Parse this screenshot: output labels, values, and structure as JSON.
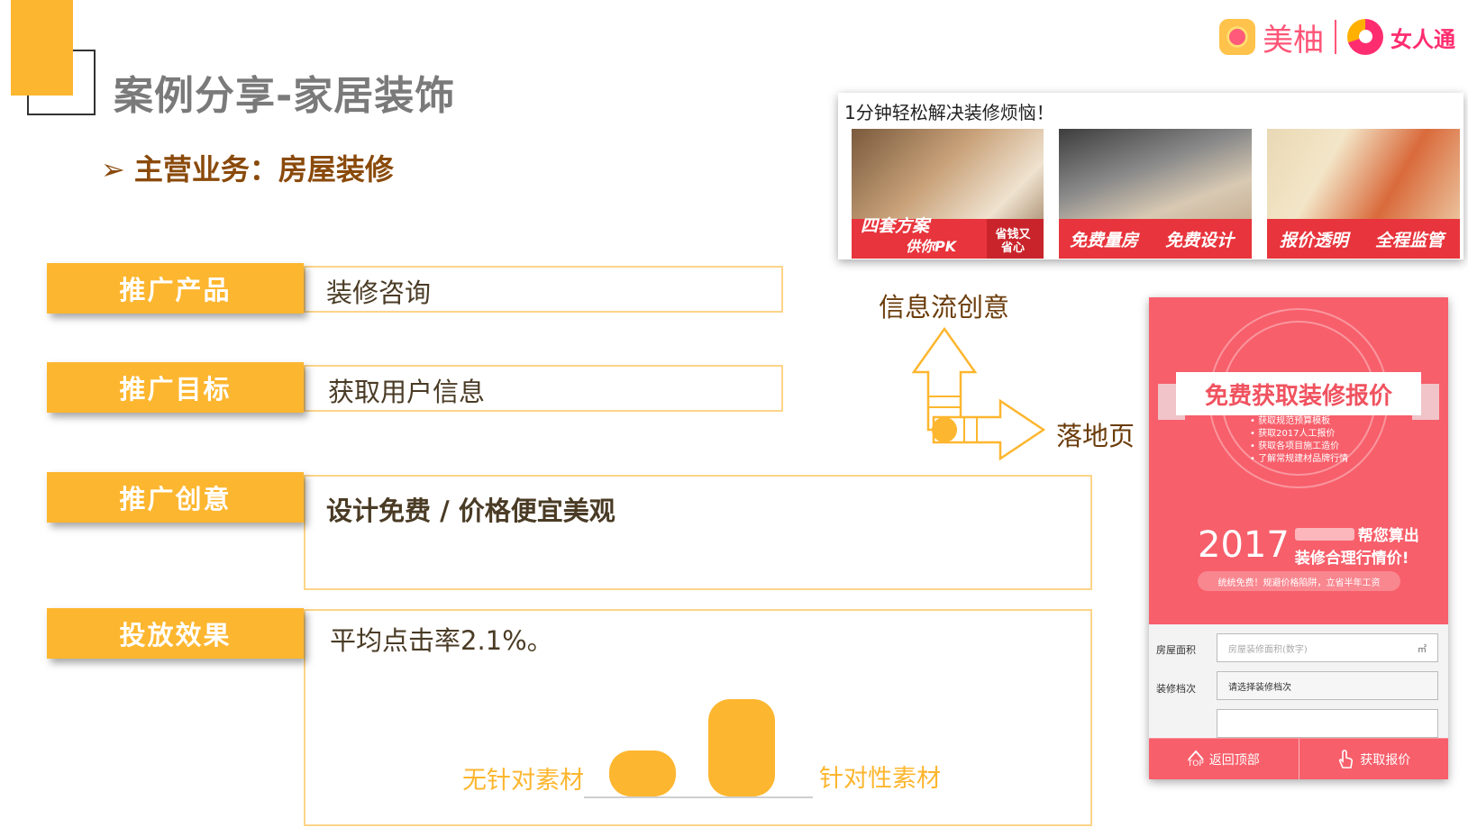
{
  "page": {
    "title": "案例分享-家居装饰",
    "subtitle_arrow": "➢",
    "subtitle": "主营业务：房屋装修"
  },
  "logos": {
    "meiyou": "美柚",
    "nvrentong": "女人通"
  },
  "rows": [
    {
      "label": "推广产品",
      "value": "装修咨询"
    },
    {
      "label": "推广目标",
      "value": "获取用户信息"
    },
    {
      "label": "推广创意",
      "value": "设计免费 / 价格便宜美观"
    },
    {
      "label": "投放效果",
      "value": "平均点击率2.1%。"
    }
  ],
  "chart_data": {
    "type": "bar",
    "categories": [
      "无针对素材",
      "针对性素材"
    ],
    "values": [
      1,
      2.1
    ],
    "title": "",
    "xlabel": "",
    "ylabel": ""
  },
  "feed_ad": {
    "title": "1分钟轻松解决装修烦恼！",
    "images": [
      {
        "caption1": "四套方案",
        "caption2": "供你PK",
        "side": "省钱又省心"
      },
      {
        "caption1": "免费量房",
        "caption2": "免费设计"
      },
      {
        "caption1": "报价透明",
        "caption2": "全程监管"
      }
    ]
  },
  "flow": {
    "feed_label": "信息流创意",
    "landing_label": "落地页"
  },
  "landing": {
    "headline": "免费获取装修报价",
    "bullets": [
      "• 获取规范预算模板",
      "• 获取2017人工报价",
      "• 获取各项目施工造价",
      "• 了解常规建材品牌行情"
    ],
    "year": "2017",
    "slogan1": "帮您算出",
    "slogan2": "装修合理行情价!",
    "pill": "统统免费！规避价格陷阱，立省半年工资",
    "form": {
      "area_label": "房屋面积",
      "area_placeholder": "房屋装修面积(数字)",
      "area_unit": "㎡",
      "level_label": "装修档次",
      "level_value": "请选择装修档次"
    },
    "buttons": {
      "top": "返回顶部",
      "top_badge": "TOP",
      "quote": "获取报价"
    }
  },
  "colors": {
    "accent": "#fdb62f",
    "landing_red": "#f75f6b",
    "feed_red": "#e8343c",
    "subtitle_brown": "#8a4a0b"
  }
}
